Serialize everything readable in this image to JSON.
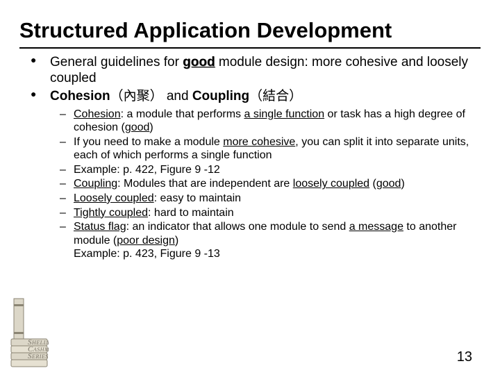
{
  "title": "Structured Application Development",
  "bullets": {
    "b1": {
      "pre": "General guidelines for ",
      "good": "good",
      "post": " module design: more cohesive and loosely coupled"
    },
    "b2": {
      "pre": "Cohesion",
      "p1": "（內聚） and ",
      "p2": "Coupling",
      "p3": "（結合）"
    }
  },
  "sub": {
    "s1": {
      "a": "Cohesion",
      "b": ": a module that performs ",
      "c": "a single function",
      "d": " or task has a high degree of cohesion (",
      "e": "good",
      "f": ")"
    },
    "s2": {
      "a": "If you need to make a module ",
      "b": "more cohesive",
      "c": ", you can split it into separate units, each of which performs a single function"
    },
    "s3": "Example: p. 422, Figure 9 -12",
    "s4": {
      "a": "Coupling",
      "b": ": Modules that are independent are ",
      "c": "loosely coupled",
      "d": " (",
      "e": "good",
      "f": ")"
    },
    "s5": {
      "a": "Loosely coupled",
      "b": ": easy to maintain"
    },
    "s6": {
      "a": "Tightly coupled",
      "b": ": hard to maintain"
    },
    "s7": {
      "a": "Status flag",
      "b": ": an indicator that allows one module to send ",
      "c": "a message",
      "d": " to another module   (",
      "e": "poor design",
      "f": ")",
      "g": "Example: p. 423, Figure 9 -13"
    }
  },
  "page_number": "13",
  "logo": {
    "line1": "Shelly",
    "line2": "Cashman",
    "line3": "Series"
  }
}
